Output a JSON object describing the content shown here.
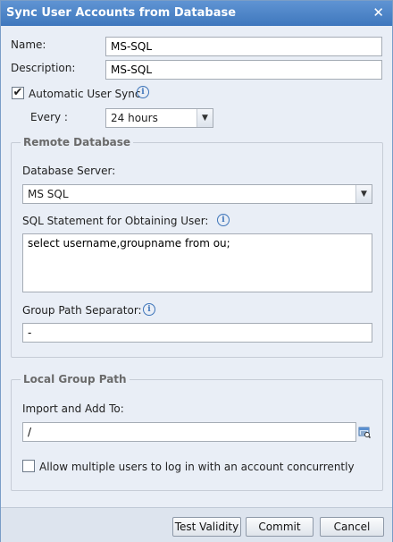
{
  "dialog": {
    "title": "Sync User Accounts from Database",
    "close_icon": "close-icon"
  },
  "form": {
    "name_label": "Name:",
    "name_value": "MS-SQL",
    "description_label": "Description:",
    "description_value": "MS-SQL",
    "auto_sync_label": "Automatic User Sync",
    "auto_sync_checked": true,
    "every_label": "Every :",
    "every_value": "24 hours"
  },
  "remote_database": {
    "legend": "Remote Database",
    "server_label": "Database Server:",
    "server_value": "MS SQL",
    "sql_label": "SQL Statement for Obtaining User:",
    "sql_value": "select username,groupname from ou;",
    "separator_label": "Group Path Separator:",
    "separator_value": "-"
  },
  "local_group": {
    "legend": "Local Group Path",
    "import_label": "Import and Add To:",
    "import_value": "/",
    "concurrent_label": "Allow multiple users to log in with an account concurrently",
    "concurrent_checked": false
  },
  "buttons": {
    "test_validity": "Test Validity",
    "commit": "Commit",
    "cancel": "Cancel"
  },
  "icons": {
    "check_mark": "✔",
    "info": "i",
    "close": "✕",
    "dropdown": "▼"
  }
}
